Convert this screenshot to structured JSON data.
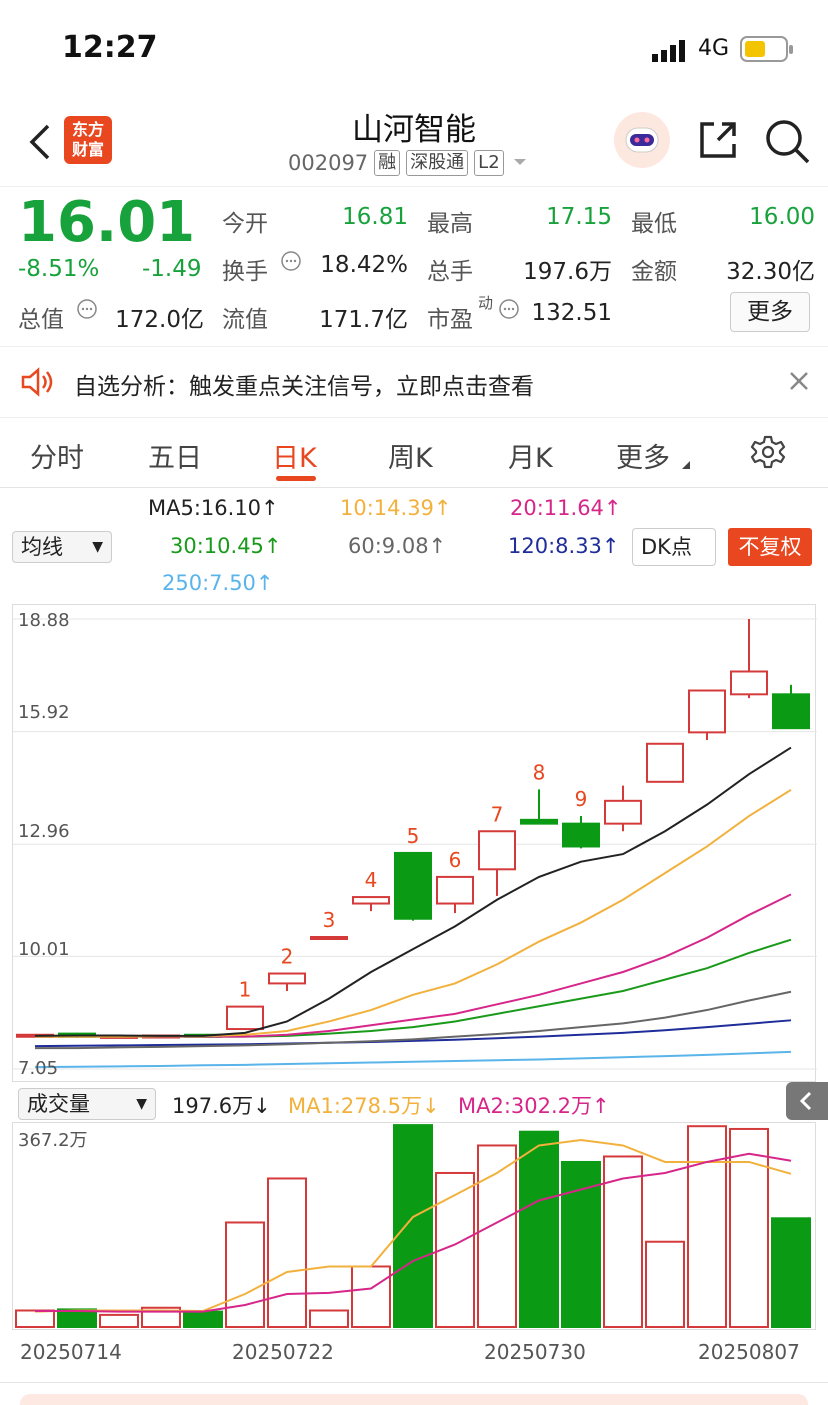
{
  "status_bar": {
    "time": "12:27",
    "network": "4G"
  },
  "header": {
    "stock_name": "山河智能",
    "stock_code": "002097",
    "tags": [
      "融",
      "深股通",
      "L2"
    ],
    "logo_text_1": "东方",
    "logo_text_2": "财富"
  },
  "quote": {
    "price": "16.01",
    "change_pct": "-8.51%",
    "change": "-1.49",
    "fields": [
      {
        "label": "今开",
        "value": "16.81"
      },
      {
        "label": "最高",
        "value": "17.15"
      },
      {
        "label": "最低",
        "value": "16.00"
      },
      {
        "label": "换手",
        "value": "18.42%"
      },
      {
        "label": "总手",
        "value": "197.6万"
      },
      {
        "label": "金额",
        "value": "32.30亿"
      },
      {
        "label": "总值",
        "value": "172.0亿"
      },
      {
        "label": "流值",
        "value": "171.7亿"
      },
      {
        "label": "市盈",
        "value": "132.51"
      }
    ],
    "pe_sup": "动",
    "more_label": "更多"
  },
  "notice": {
    "text": "自选分析：触发重点关注信号，立即点击查看"
  },
  "tabs": [
    "分时",
    "五日",
    "日K",
    "周K",
    "月K",
    "更多"
  ],
  "active_tab": "日K",
  "ma_bar": {
    "selector": "均线",
    "ma5": "MA5:16.10↑",
    "ma10": "10:14.39↑",
    "ma20": "20:11.64↑",
    "ma30": "30:10.45↑",
    "ma60": "60:9.08↑",
    "ma120": "120:8.33↑",
    "ma250": "250:7.50↑",
    "dk_label": "DK点",
    "adjust_label": "不复权"
  },
  "colors": {
    "up": "#d43a3a",
    "down": "#0a9a14",
    "ma5": "#222222",
    "ma10": "#f2b13c",
    "ma20": "#d6268a",
    "ma30": "#1a9a1a",
    "ma60": "#666666",
    "ma120": "#1f2d9a",
    "ma250": "#5ab4ea",
    "accent": "#e8471f"
  },
  "volume_bar": {
    "selector": "成交量",
    "value": "197.6万↓",
    "ma1": "MA1:278.5万↓",
    "ma2": "MA2:302.2万↑",
    "max_label": "367.2万"
  },
  "chart_data": {
    "type": "candlestick",
    "y_ticks": [
      "18.88",
      "15.92",
      "12.96",
      "10.01",
      "7.05"
    ],
    "ylim": [
      7.05,
      18.88
    ],
    "x_labels": [
      "20250714",
      "20250722",
      "20250730",
      "20250807"
    ],
    "candles": [
      {
        "o": 7.9,
        "c": 7.95,
        "h": 7.97,
        "l": 7.88,
        "v": 30
      },
      {
        "o": 7.98,
        "c": 7.9,
        "h": 8.0,
        "l": 7.87,
        "v": 32
      },
      {
        "o": 7.88,
        "c": 7.92,
        "h": 7.94,
        "l": 7.85,
        "v": 22
      },
      {
        "o": 7.9,
        "c": 7.93,
        "h": 7.95,
        "l": 7.87,
        "v": 35
      },
      {
        "o": 7.95,
        "c": 7.9,
        "h": 7.97,
        "l": 7.88,
        "v": 28
      },
      {
        "o": 8.1,
        "c": 8.69,
        "h": 8.69,
        "l": 8.1,
        "v": 190
      },
      {
        "o": 9.3,
        "c": 9.56,
        "h": 9.56,
        "l": 9.1,
        "v": 270
      },
      {
        "o": 10.52,
        "c": 10.52,
        "h": 10.52,
        "l": 10.52,
        "v": 30
      },
      {
        "o": 11.4,
        "c": 11.57,
        "h": 11.57,
        "l": 11.2,
        "v": 110
      },
      {
        "o": 12.73,
        "c": 11.0,
        "h": 12.73,
        "l": 10.95,
        "v": 367
      },
      {
        "o": 11.4,
        "c": 12.1,
        "h": 12.1,
        "l": 11.15,
        "v": 280
      },
      {
        "o": 12.3,
        "c": 13.3,
        "h": 13.3,
        "l": 11.6,
        "v": 330
      },
      {
        "o": 13.6,
        "c": 13.5,
        "h": 14.4,
        "l": 13.5,
        "v": 355
      },
      {
        "o": 13.5,
        "c": 12.9,
        "h": 13.7,
        "l": 12.85,
        "v": 300
      },
      {
        "o": 13.5,
        "c": 14.1,
        "h": 14.5,
        "l": 13.3,
        "v": 310
      },
      {
        "o": 14.6,
        "c": 15.6,
        "h": 15.6,
        "l": 14.6,
        "v": 155
      },
      {
        "o": 15.9,
        "c": 17.0,
        "h": 17.0,
        "l": 15.7,
        "v": 365
      },
      {
        "o": 16.9,
        "c": 17.5,
        "h": 18.88,
        "l": 16.8,
        "v": 360
      },
      {
        "o": 16.9,
        "c": 16.01,
        "h": 17.15,
        "l": 16.0,
        "v": 197.6
      }
    ],
    "ma5": [
      7.92,
      7.93,
      7.93,
      7.92,
      7.92,
      8.0,
      8.3,
      8.9,
      9.6,
      10.2,
      10.8,
      11.5,
      12.1,
      12.5,
      12.7,
      13.3,
      14.0,
      14.8,
      15.5
    ],
    "ma10": [
      7.9,
      7.9,
      7.9,
      7.91,
      7.91,
      7.95,
      8.05,
      8.3,
      8.6,
      9.0,
      9.3,
      9.8,
      10.4,
      10.9,
      11.5,
      12.2,
      12.9,
      13.7,
      14.39
    ],
    "ma20": [
      7.9,
      7.9,
      7.9,
      7.9,
      7.9,
      7.9,
      7.95,
      8.05,
      8.2,
      8.35,
      8.5,
      8.75,
      9.0,
      9.3,
      9.6,
      10.0,
      10.5,
      11.1,
      11.64
    ],
    "ma30": [
      7.9,
      7.9,
      7.9,
      7.9,
      7.9,
      7.9,
      7.92,
      7.98,
      8.05,
      8.15,
      8.3,
      8.5,
      8.7,
      8.9,
      9.1,
      9.4,
      9.7,
      10.1,
      10.45
    ],
    "ma60": [
      7.6,
      7.6,
      7.62,
      7.63,
      7.65,
      7.67,
      7.7,
      7.74,
      7.78,
      7.83,
      7.9,
      7.97,
      8.05,
      8.15,
      8.25,
      8.4,
      8.6,
      8.85,
      9.08
    ],
    "ma120": [
      7.65,
      7.66,
      7.67,
      7.68,
      7.69,
      7.7,
      7.72,
      7.74,
      7.76,
      7.79,
      7.82,
      7.86,
      7.9,
      7.95,
      8.0,
      8.07,
      8.15,
      8.24,
      8.33
    ],
    "ma250": [
      7.1,
      7.11,
      7.12,
      7.13,
      7.15,
      7.16,
      7.18,
      7.2,
      7.22,
      7.24,
      7.26,
      7.28,
      7.3,
      7.33,
      7.36,
      7.39,
      7.42,
      7.46,
      7.5
    ],
    "vol_ma1": [
      28,
      30,
      30,
      30,
      29,
      60,
      100,
      110,
      110,
      200,
      240,
      280,
      330,
      340,
      330,
      300,
      300,
      300,
      278.5
    ],
    "vol_ma2": [
      29,
      29,
      28,
      28,
      28,
      40,
      60,
      62,
      70,
      120,
      150,
      190,
      230,
      250,
      270,
      280,
      300,
      315,
      302.2
    ],
    "vol_max": 367.2,
    "signals": [
      {
        "i": 5,
        "text": "1"
      },
      {
        "i": 6,
        "text": "2"
      },
      {
        "i": 7,
        "text": "3"
      },
      {
        "i": 8,
        "text": "4"
      },
      {
        "i": 9,
        "text": "5"
      },
      {
        "i": 10,
        "text": "6"
      },
      {
        "i": 11,
        "text": "7"
      },
      {
        "i": 12,
        "text": "8"
      },
      {
        "i": 13,
        "text": "9"
      }
    ]
  },
  "volume_dates": [
    "20250714",
    "20250722",
    "20250730",
    "20250807"
  ]
}
